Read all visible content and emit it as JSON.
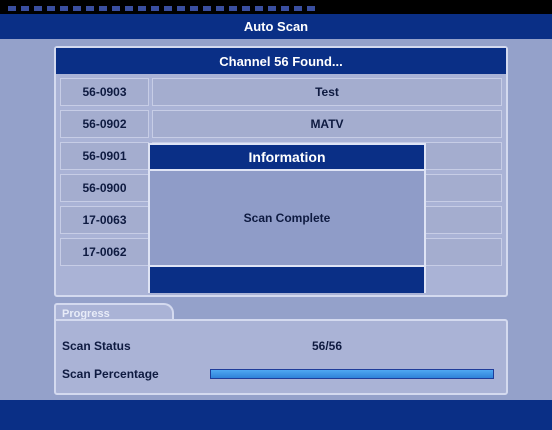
{
  "header": {
    "title": "Auto Scan"
  },
  "scan": {
    "found_text": "Channel 56 Found...",
    "channels": [
      {
        "number": "56-0903",
        "name": "Test"
      },
      {
        "number": "56-0902",
        "name": "MATV"
      },
      {
        "number": "56-0901",
        "name": ""
      },
      {
        "number": "56-0900",
        "name": ""
      },
      {
        "number": "17-0063",
        "name": ""
      },
      {
        "number": "17-0062",
        "name": ""
      }
    ]
  },
  "dialog": {
    "title": "Information",
    "message": "Scan Complete"
  },
  "progress": {
    "tab_label": "Progress",
    "status_label": "Scan Status",
    "status_value": "56/56",
    "percentage_label": "Scan Percentage",
    "percentage_fraction": 1.0
  },
  "colors": {
    "accent": "#0a2f86",
    "background": "#94a1ca",
    "progress_fill": "#3a8fe0"
  }
}
